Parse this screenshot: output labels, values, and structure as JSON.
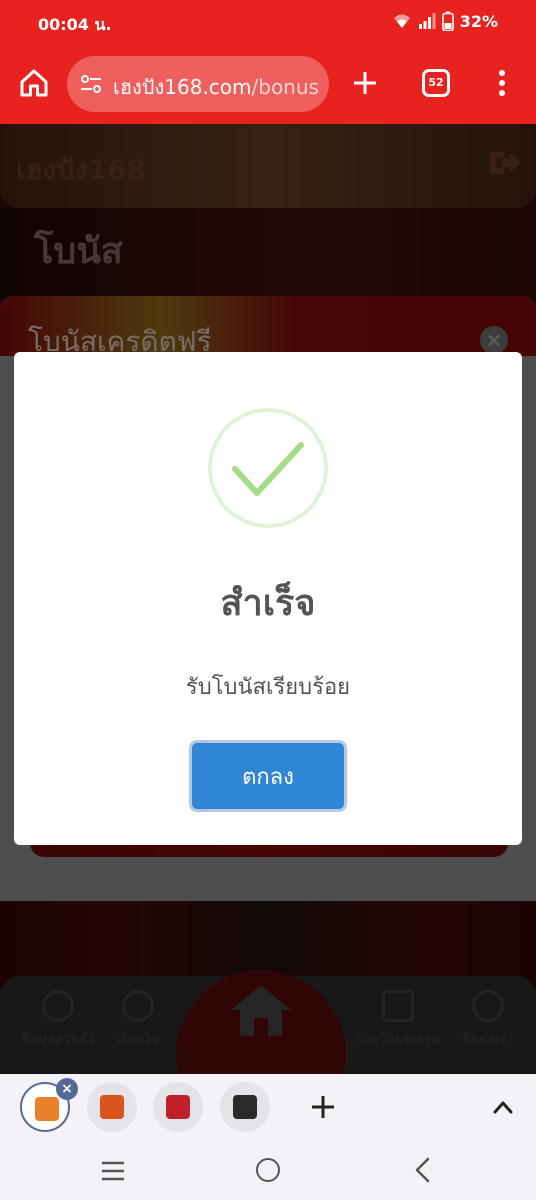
{
  "status_bar": {
    "time": "00:04 น.",
    "battery": "32%"
  },
  "browser": {
    "url_host": "เฮงปัง168.com",
    "url_path": "/bonus",
    "tab_count": "52"
  },
  "site": {
    "logo_text": "เฮงปัง168",
    "page_title": "โบนัส",
    "panel_title": "โบนัสเครดิตฟรี",
    "nav": [
      {
        "label": "ข้อมูลส่วนตัว",
        "icon": "profile-icon"
      },
      {
        "label": "เงื่อนไข",
        "icon": "help-icon"
      },
      {
        "label": "ประวัติธุรกรรม",
        "icon": "list-icon"
      },
      {
        "label": "ติดต่อเรา",
        "icon": "line-chat-icon"
      }
    ]
  },
  "modal": {
    "title": "สำเร็จ",
    "message": "รับโบนัสเรียบร้อย",
    "ok_label": "ตกลง"
  },
  "colors": {
    "browser_red": "#e8221f",
    "button_blue": "#3085d6",
    "success_green": "#a5dc86"
  }
}
